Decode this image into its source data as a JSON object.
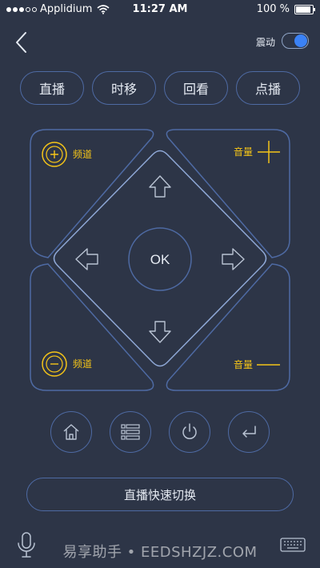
{
  "status_bar": {
    "carrier": "Applidium",
    "time": "11:27 AM",
    "battery": "100 %",
    "battery_level": 1.0
  },
  "header": {
    "vibration_label": "震动",
    "vibration_on": true
  },
  "modes": [
    {
      "label": "直播"
    },
    {
      "label": "时移"
    },
    {
      "label": "回看"
    },
    {
      "label": "点播"
    }
  ],
  "pad": {
    "ok_label": "OK",
    "channel_up_label": "频道",
    "channel_down_label": "频道",
    "volume_up_label": "音量",
    "volume_down_label": "音量"
  },
  "quick_switch_label": "直播快速切换",
  "watermark": "易享助手 • EEDSHZJZ.COM",
  "colors": {
    "background": "#2d3547",
    "accent_blue": "#4e6aa3",
    "accent_yellow": "#f5c518",
    "toggle_blue": "#3b82f6"
  },
  "icons": [
    "back-chevron-icon",
    "home-icon",
    "menu-list-icon",
    "power-icon",
    "return-icon",
    "microphone-icon",
    "keyboard-icon"
  ]
}
